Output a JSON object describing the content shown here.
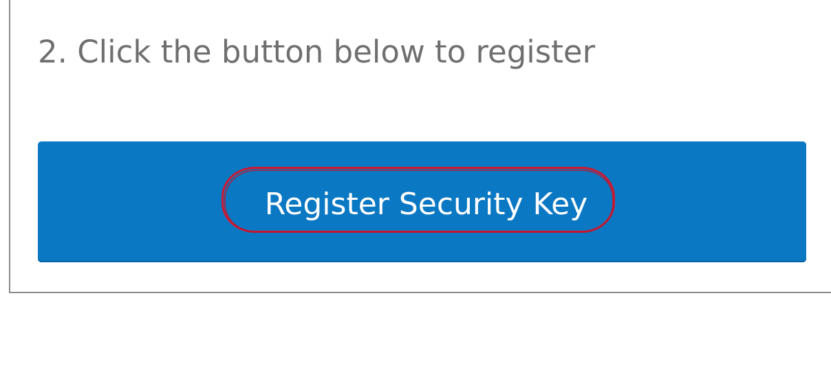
{
  "step": {
    "instruction": "2. Click the button below to register"
  },
  "register_button": {
    "label": "Register Security Key"
  },
  "colors": {
    "button_background": "#0b78c3",
    "button_text": "#ffffff",
    "instruction_text": "#6f6f6f",
    "card_border": "#8a8a8a",
    "highlight_annotation": "#d3172e"
  }
}
